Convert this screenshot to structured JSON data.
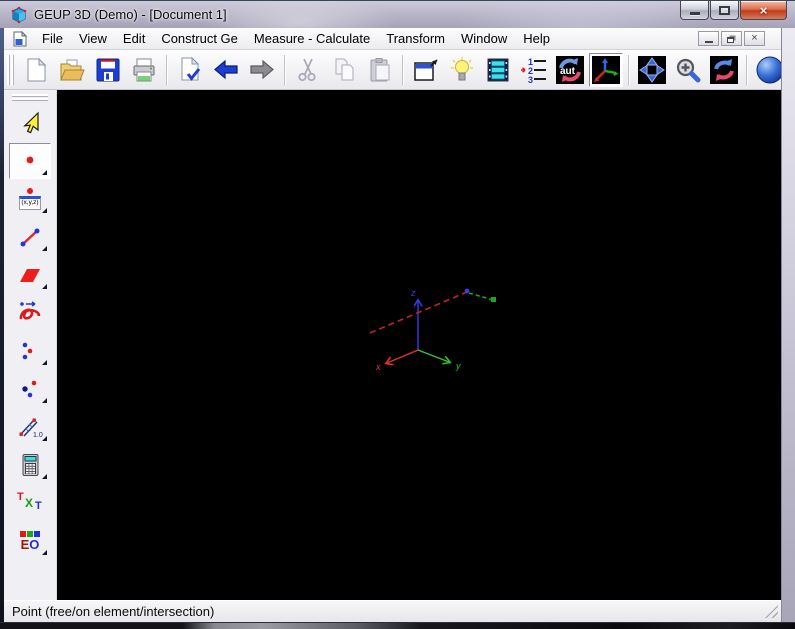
{
  "window": {
    "title": "GEUP 3D (Demo) - [Document 1]"
  },
  "menubar": {
    "items": [
      "File",
      "View",
      "Edit",
      "Construct Ge",
      "Measure - Calculate",
      "Transform",
      "Window",
      "Help"
    ]
  },
  "toolbar": {
    "steps_icon": {
      "d1": "1",
      "d2": "2",
      "d3": "3"
    },
    "auto_label": "aut"
  },
  "sidebar": {
    "xyz_label": "(x,y,z)",
    "measure_label": "1.0",
    "text_letters": {
      "t1": "T",
      "x": "X",
      "t2": "T"
    },
    "eo_letters": {
      "e": "E",
      "o": "O"
    }
  },
  "canvas": {
    "axis_labels": {
      "x": "x",
      "y": "y",
      "z": "z"
    }
  },
  "statusbar": {
    "text": "Point (free/on element/intersection)"
  },
  "colors": {
    "canvas_bg": "#000000",
    "axis_x": "#e83030",
    "axis_y": "#2fc82f",
    "axis_z": "#3a3af0",
    "accent_blue": "#1d3ed6",
    "close_red": "#c83a26",
    "selection_yellow": "#ffee3a"
  },
  "icons": {
    "close-glyph": "×",
    "app-cube-icon": "blue 3d cube with red vertices",
    "minimize-icon": "horizontal bar",
    "maximize-icon": "square outline",
    "close-icon": "white x on red",
    "mdi-minimize-icon": "horizontal bar",
    "mdi-restore-icon": "overlapping squares",
    "mdi-close-icon": "x",
    "new-document-icon": "blank page",
    "open-folder-icon": "folder with document",
    "save-icon": "blue floppy disk",
    "print-icon": "printer",
    "check-document-icon": "page with blue checkmark",
    "undo-icon": "blue left arrow",
    "redo-icon": "gray right arrow",
    "cut-icon": "gray scissors",
    "copy-icon": "two gray pages",
    "paste-icon": "gray clipboard",
    "fit-window-icon": "window with diagonal arrow",
    "lightbulb-icon": "yellow light bulb",
    "animation-icon": "cyan film strip",
    "steps-icon": "numbered list 1 2 3 with red arrow",
    "auto-rotate-icon": "aut text with blue and red curved arrows",
    "axes-icon": "3d coordinate axes on black",
    "pan-view-icon": "four blue triangles on black",
    "zoom-in-icon": "magnifier with plus",
    "rotate-view-icon": "blue and red circular arrows on black",
    "sphere-icon": "blue sphere",
    "select-arrow-icon": "yellow pointer arrow",
    "point-icon": "red point",
    "point-xyz-icon": "red point with coordinate label",
    "segment-icon": "red segment with blue endpoints",
    "plane-icon": "red parallelogram",
    "curve-icon": "red loop curve with blue arrow",
    "intersection-icon": "blue red blue points",
    "midpoint-icon": "red navy blue points",
    "measure-transfer-icon": "hatched segment with 1.0",
    "calculator-icon": "calculator with cyan display",
    "text-icon": "TXT colored letters",
    "appearance-icon": "EO with red green blue squares",
    "dropdown-corner-icon": "small corner triangle",
    "resize-grip-icon": "diagonal grip lines"
  }
}
